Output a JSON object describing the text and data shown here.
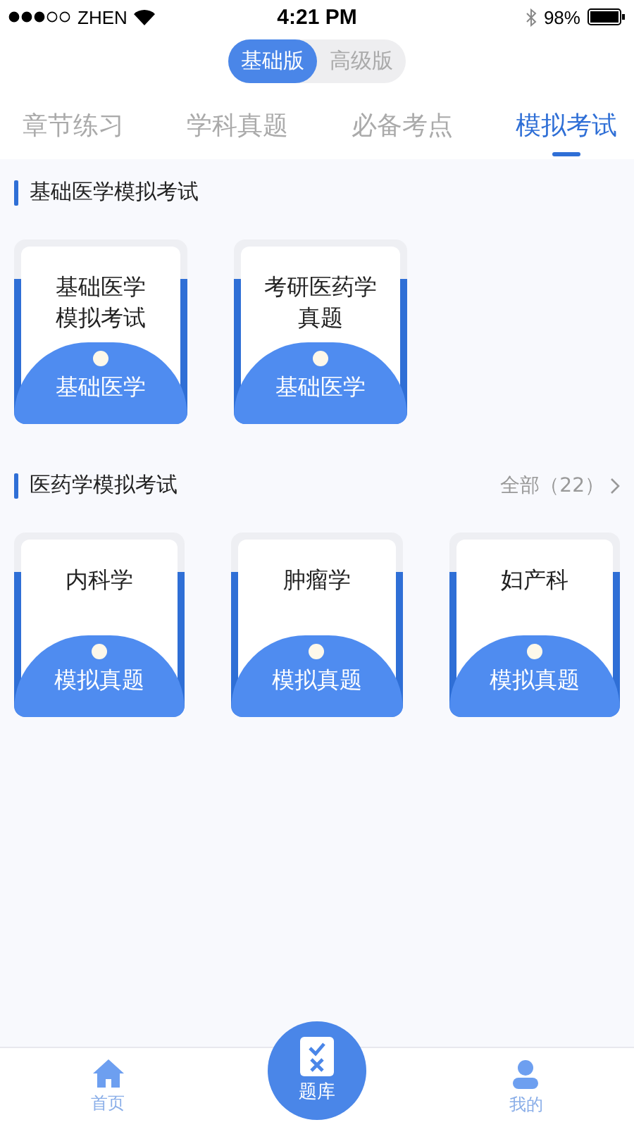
{
  "status_bar": {
    "carrier": "ZHEN",
    "time": "4:21 PM",
    "battery": "98%"
  },
  "version_switch": [
    {
      "label": "基础版",
      "selected": true
    },
    {
      "label": "高级版",
      "selected": false
    }
  ],
  "tabs": [
    {
      "label": "章节练习",
      "selected": false
    },
    {
      "label": "学科真题",
      "selected": false
    },
    {
      "label": "必备考点",
      "selected": false
    },
    {
      "label": "模拟考试",
      "selected": true
    }
  ],
  "sections": [
    {
      "title": "基础医学模拟考试",
      "cards": [
        {
          "title": [
            "基础医学",
            "模拟考试"
          ],
          "tag": "基础医学"
        },
        {
          "title": [
            "考研医药学",
            "真题"
          ],
          "tag": "基础医学"
        }
      ]
    },
    {
      "title": "医药学模拟考试",
      "more": "全部（22）",
      "cards": [
        {
          "title": [
            "内科学"
          ],
          "tag": "模拟真题"
        },
        {
          "title": [
            "肿瘤学"
          ],
          "tag": "模拟真题"
        },
        {
          "title": [
            "妇产科"
          ],
          "tag": "模拟真题"
        }
      ]
    }
  ],
  "bottom_nav": [
    {
      "label": "首页",
      "kind": "home",
      "selected": false
    },
    {
      "label": "题库",
      "kind": "center",
      "selected": true
    },
    {
      "label": "我的",
      "kind": "profile",
      "selected": false
    }
  ]
}
